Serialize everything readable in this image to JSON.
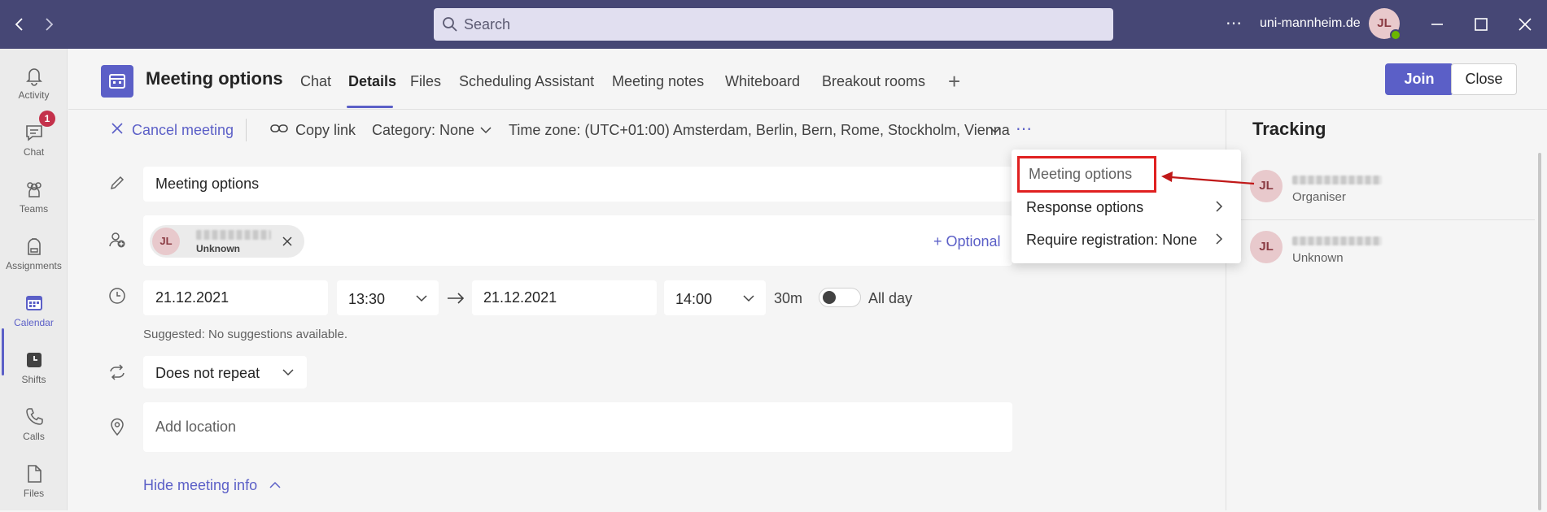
{
  "titlebar": {
    "search_placeholder": "Search",
    "more": "⋯",
    "org": "uni-mannheim.de",
    "avatar_initials": "JL"
  },
  "rail": {
    "items": [
      {
        "label": "Activity"
      },
      {
        "label": "Chat",
        "badge": "1"
      },
      {
        "label": "Teams"
      },
      {
        "label": "Assignments"
      },
      {
        "label": "Calendar"
      },
      {
        "label": "Shifts"
      },
      {
        "label": "Calls"
      },
      {
        "label": "Files"
      }
    ]
  },
  "header": {
    "title": "Meeting options",
    "tabs": [
      "Chat",
      "Details",
      "Files",
      "Scheduling Assistant",
      "Meeting notes",
      "Whiteboard",
      "Breakout rooms"
    ],
    "active_tab": "Details",
    "add_tab": "+",
    "join_label": "Join",
    "close_label": "Close"
  },
  "toolbar": {
    "cancel_label": "Cancel meeting",
    "copy_link_label": "Copy link",
    "category_label": "Category: None",
    "timezone_label": "Time zone: (UTC+01:00) Amsterdam, Berlin, Bern, Rome, Stockholm, Vienna",
    "more": "⋯"
  },
  "form": {
    "title_value": "Meeting options",
    "attendee": {
      "initials": "JL",
      "status": "Unknown"
    },
    "optional_label": "+ Optional",
    "start_date": "21.12.2021",
    "start_time": "13:30",
    "end_date": "21.12.2021",
    "end_time": "14:00",
    "duration": "30m",
    "all_day_label": "All day",
    "suggestion": "Suggested: No suggestions available.",
    "repeat_value": "Does not repeat",
    "location_placeholder": "Add location",
    "hide_info_label": "Hide meeting info"
  },
  "menu": {
    "items": [
      "Meeting options",
      "Response options",
      "Require registration: None"
    ]
  },
  "tracking": {
    "title": "Tracking",
    "people": [
      {
        "initials": "JL",
        "role": "Organiser"
      },
      {
        "initials": "JL",
        "role": "Unknown"
      }
    ]
  },
  "colors": {
    "titlebar": "#464775",
    "accent": "#5b5fc7",
    "highlight": "#e02020"
  }
}
